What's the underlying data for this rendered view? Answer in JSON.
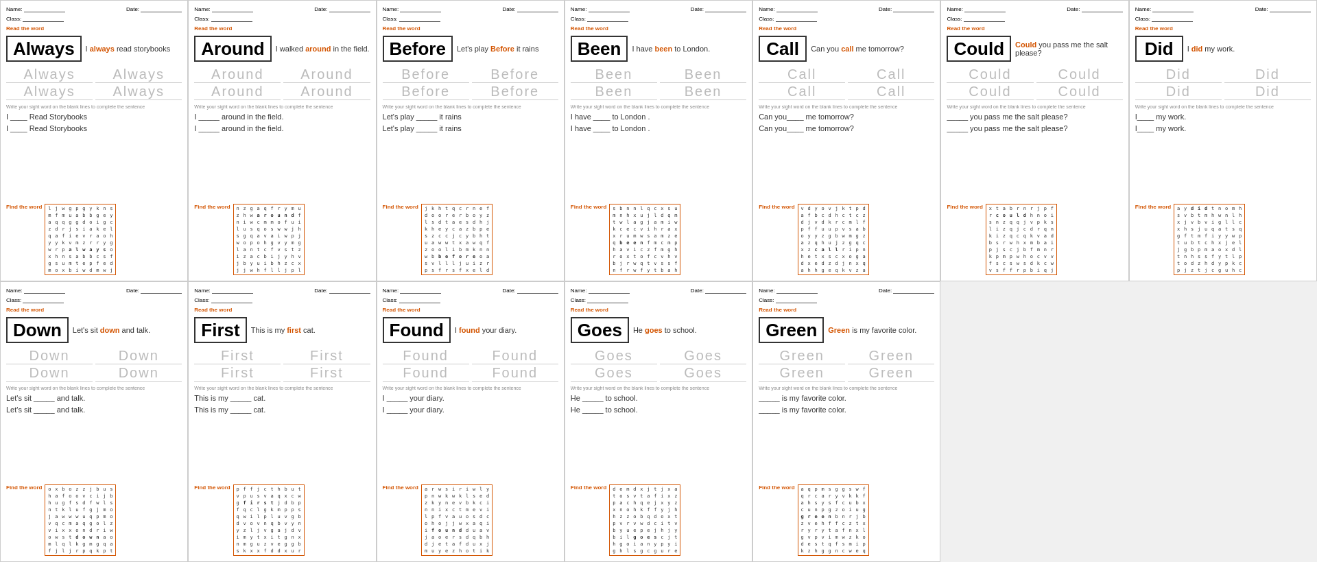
{
  "cards": [
    {
      "id": "always",
      "word": "Always",
      "sentence": "I always read storybooks",
      "highlight": "always",
      "traceWords": [
        "Always Always",
        "Always Always"
      ],
      "fillSentences": [
        "I ____ Read Storybooks",
        "I ____ Read Storybooks"
      ],
      "gridHighlight": "always",
      "color": "#d35400"
    },
    {
      "id": "around",
      "word": "Around",
      "sentence": "I walked around in the field.",
      "highlight": "around",
      "traceWords": [
        "Around Around",
        "Around Around"
      ],
      "fillSentences": [
        "I _____ around in the field.",
        "I _____ around in the field."
      ],
      "gridHighlight": "around",
      "color": "#d35400"
    },
    {
      "id": "before",
      "word": "Before",
      "sentence": "Let's play Before it rains",
      "highlight": "Before",
      "traceWords": [
        "Before Before",
        "Before Before"
      ],
      "fillSentences": [
        "Let's play _____ it rains",
        "Let's play _____ it rains"
      ],
      "gridHighlight": "before",
      "color": "#d35400"
    },
    {
      "id": "been",
      "word": "Been",
      "sentence": "I have been to London.",
      "highlight": "been",
      "traceWords": [
        "Been Been",
        "Been Been"
      ],
      "fillSentences": [
        "I have ____ to London .",
        "I have ____ to London ."
      ],
      "gridHighlight": "been",
      "color": "#d35400"
    },
    {
      "id": "call",
      "word": "Call",
      "sentence": "Can you call me tomorrow?",
      "highlight": "call",
      "traceWords": [
        "Call Call",
        "Call Call"
      ],
      "fillSentences": [
        "Can you____ me tomorrow?",
        "Can you____ me tomorrow?"
      ],
      "gridHighlight": "call",
      "color": "#d35400"
    },
    {
      "id": "could",
      "word": "Could",
      "sentence": "Could you pass me the salt please?",
      "highlight": "Could",
      "traceWords": [
        "Could Could",
        "Could Could"
      ],
      "fillSentences": [
        "_____ you pass me the salt please?",
        "_____ you pass me the salt please?"
      ],
      "gridHighlight": "could",
      "color": "#d35400"
    },
    {
      "id": "did",
      "word": "Did",
      "sentence": "I did my work.",
      "highlight": "did",
      "traceWords": [
        "Did Did",
        "Did Did"
      ],
      "fillSentences": [
        "I____ my work.",
        "I____ my work."
      ],
      "gridHighlight": "did",
      "color": "#d35400"
    },
    {
      "id": "down",
      "word": "Down",
      "sentence": "Let's sit down and talk.",
      "highlight": "down",
      "traceWords": [
        "Down Down",
        "Down Down"
      ],
      "fillSentences": [
        "Let's sit _____ and talk.",
        "Let's sit _____ and talk."
      ],
      "gridHighlight": "down",
      "color": "#d35400"
    },
    {
      "id": "first",
      "word": "First",
      "sentence": "This is my first cat.",
      "highlight": "first",
      "traceWords": [
        "First First",
        "First First"
      ],
      "fillSentences": [
        "This is my _____ cat.",
        "This is my _____ cat."
      ],
      "gridHighlight": "first",
      "color": "#d35400"
    },
    {
      "id": "found",
      "word": "Found",
      "sentence": "I found your diary.",
      "highlight": "found",
      "traceWords": [
        "Found Found",
        "Found Found"
      ],
      "fillSentences": [
        "I _____ your diary.",
        "I _____ your diary."
      ],
      "gridHighlight": "found",
      "color": "#d35400"
    },
    {
      "id": "goes",
      "word": "Goes",
      "sentence": "He goes to school.",
      "highlight": "goes",
      "traceWords": [
        "Goes Goes",
        "Goes Goes"
      ],
      "fillSentences": [
        "He _____ to school.",
        "He _____ to school."
      ],
      "gridHighlight": "goes",
      "color": "#d35400"
    },
    {
      "id": "green",
      "word": "Green",
      "sentence": "Green is my favorite color.",
      "highlight": "Green",
      "traceWords": [
        "Green Green",
        "Green Green"
      ],
      "fillSentences": [
        "_____ is my favorite color.",
        "_____ is my favorite color."
      ],
      "gridHighlight": "green",
      "color": "#d35400"
    }
  ],
  "labels": {
    "name": "Name:",
    "class": "Class:",
    "date": "Date:",
    "readTheWord": "Read the word",
    "findTheWord": "Find the word",
    "writeInstruction": "Write your sight word on the blank lines to complete the sentence"
  }
}
